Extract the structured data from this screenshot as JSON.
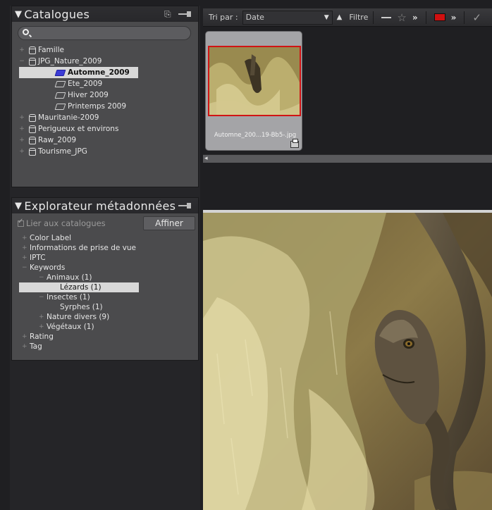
{
  "catalogues": {
    "title": "Catalogues",
    "search_placeholder": "",
    "items": [
      {
        "label": "Famille",
        "expand": "+"
      },
      {
        "label": "JPG_Nature_2009",
        "expand": "−"
      },
      {
        "label": "Automne_2009"
      },
      {
        "label": "Ete_2009"
      },
      {
        "label": "Hiver 2009"
      },
      {
        "label": "Printemps 2009"
      },
      {
        "label": "Mauritanie-2009",
        "expand": "+"
      },
      {
        "label": "Perigueux et environs",
        "expand": "+"
      },
      {
        "label": "Raw_2009",
        "expand": "+"
      },
      {
        "label": "Tourisme_JPG",
        "expand": "+"
      }
    ]
  },
  "metadata": {
    "title": "Explorateur métadonnées",
    "link_label": "Lier aux catalogues",
    "refine_label": "Affiner",
    "items": [
      {
        "label": "Color Label",
        "expand": "+"
      },
      {
        "label": "Informations de prise de vue",
        "expand": "+"
      },
      {
        "label": "IPTC",
        "expand": "+"
      },
      {
        "label": "Keywords",
        "expand": "−"
      },
      {
        "label": "Animaux (1)",
        "expand": "−"
      },
      {
        "label": "Lézards (1)"
      },
      {
        "label": "Insectes (1)",
        "expand": "−"
      },
      {
        "label": "Syrphes (1)"
      },
      {
        "label": "Nature divers (9)",
        "expand": "+"
      },
      {
        "label": "Végétaux (1)",
        "expand": "+"
      },
      {
        "label": "Rating",
        "expand": "+"
      },
      {
        "label": "Tag",
        "expand": "+"
      }
    ]
  },
  "toolbar": {
    "sort_label": "Tri par :",
    "sort_value": "Date",
    "filter_label": "Filtre",
    "label_color": "#d01010"
  },
  "browser": {
    "thumb_caption": "Automne_200...19-Bb5-.jpg"
  }
}
